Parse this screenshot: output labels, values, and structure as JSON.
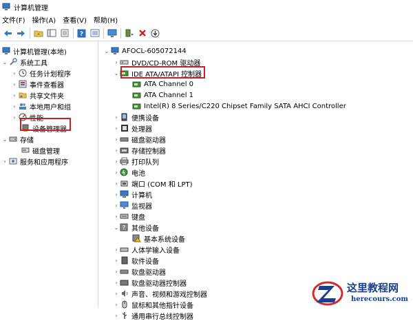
{
  "window": {
    "title": "计算机管理"
  },
  "menu": [
    "文件(F)",
    "操作(A)",
    "查看(V)",
    "帮助(H)"
  ],
  "left_tree": [
    {
      "label": "计算机管理(本地)"
    },
    {
      "label": "系统工具"
    },
    {
      "label": "任务计划程序"
    },
    {
      "label": "事件查看器"
    },
    {
      "label": "共享文件夹"
    },
    {
      "label": "本地用户和组"
    },
    {
      "label": "性能"
    },
    {
      "label": "设备管理器"
    },
    {
      "label": "存储"
    },
    {
      "label": "磁盘管理"
    },
    {
      "label": "服务和应用程序"
    }
  ],
  "device_tree": {
    "root": "AFOCL-605072144",
    "items": [
      {
        "label": "DVD/CD-ROM 驱动器"
      },
      {
        "label": "IDE ATA/ATAPI 控制器"
      },
      {
        "label": "ATA Channel 0"
      },
      {
        "label": "ATA Channel 1"
      },
      {
        "label": "Intel(R) 8 Series/C220 Chipset Family SATA AHCI Controller"
      },
      {
        "label": "便携设备"
      },
      {
        "label": "处理器"
      },
      {
        "label": "磁盘驱动器"
      },
      {
        "label": "存储控制器"
      },
      {
        "label": "打印队列"
      },
      {
        "label": "电池"
      },
      {
        "label": "端口 (COM 和 LPT)"
      },
      {
        "label": "计算机"
      },
      {
        "label": "监视器"
      },
      {
        "label": "键盘"
      },
      {
        "label": "其他设备"
      },
      {
        "label": "基本系统设备"
      },
      {
        "label": "人体学输入设备"
      },
      {
        "label": "软件设备"
      },
      {
        "label": "软盘驱动器"
      },
      {
        "label": "软盘驱动器控制器"
      },
      {
        "label": "声音、视频和游戏控制器"
      },
      {
        "label": "鼠标和其他指针设备"
      },
      {
        "label": "通用串行总线控制器"
      }
    ]
  },
  "watermark": {
    "title": "这里教程网",
    "url": "herecours.com"
  },
  "colors": {
    "highlight_border": "#c41f24",
    "logo_blue": "#1a3f8f",
    "logo_red": "#d42a2a"
  }
}
